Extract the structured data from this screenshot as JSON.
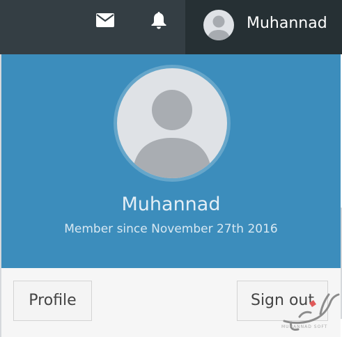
{
  "navbar": {
    "messages_icon": "envelope-icon",
    "notifications_icon": "bell-icon",
    "user_avatar_icon": "user-silhouette-icon",
    "username": "Muhannad",
    "background": "#343e44",
    "user_zone_background": "#263034"
  },
  "user_menu": {
    "header": {
      "avatar_icon": "user-silhouette-icon",
      "name": "Muhannad",
      "member_since": "Member since November 27th 2016",
      "background": "#3c8dbc"
    },
    "footer": {
      "profile_label": "Profile",
      "signout_label": "Sign out"
    }
  },
  "watermark": {
    "caption": "MUHANNAD SOFT",
    "mark_color": "#e05a5a"
  }
}
